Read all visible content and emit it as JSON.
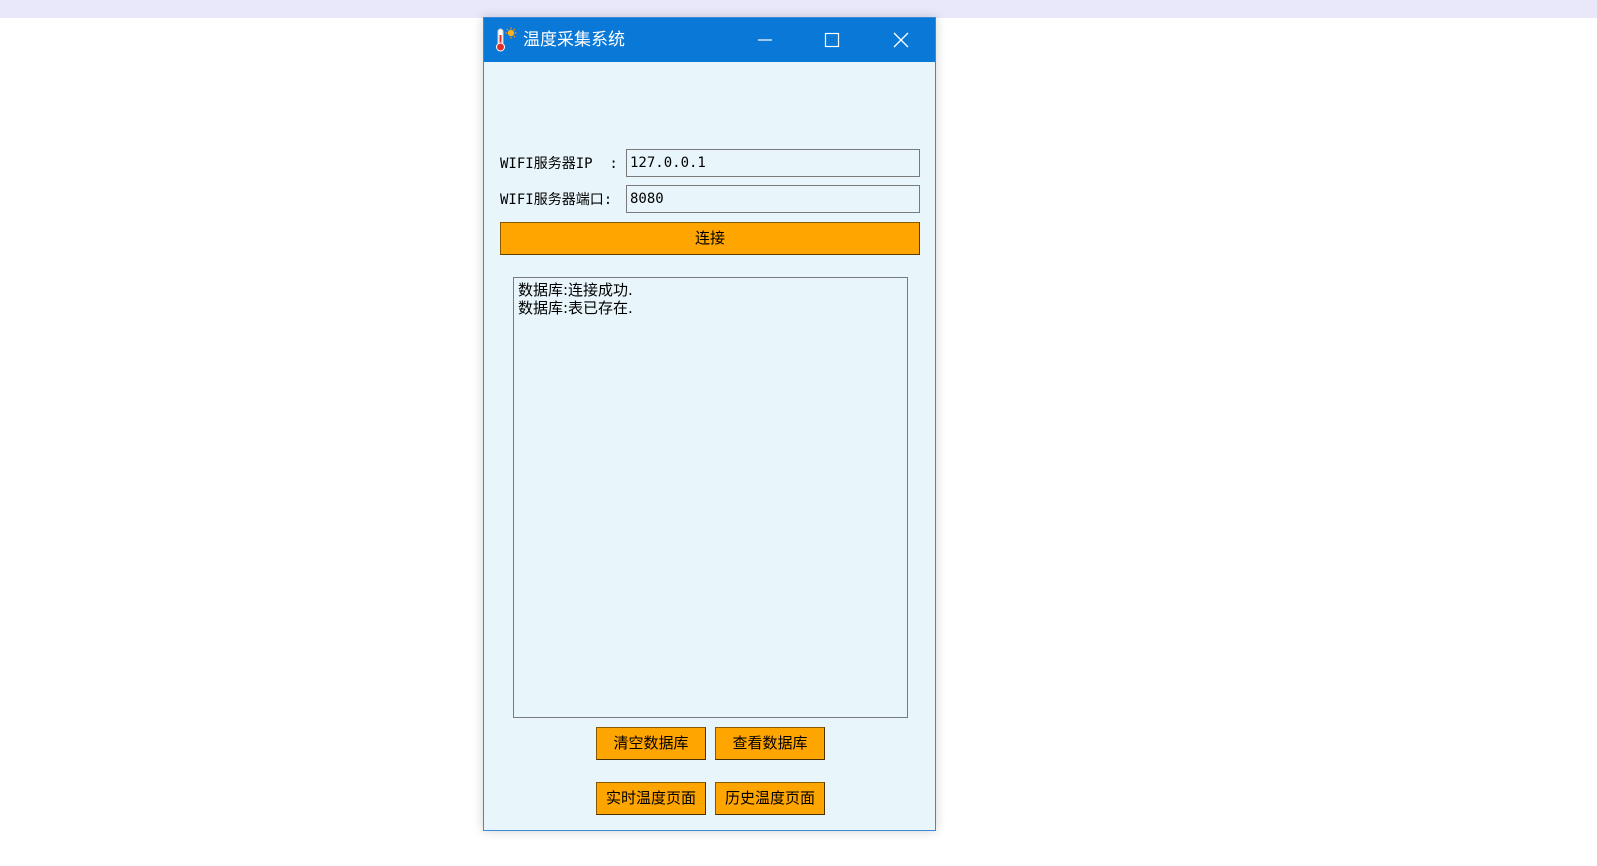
{
  "window": {
    "title": "温度采集系统",
    "app_icon": "thermometer-sun-icon",
    "controls": [
      "minimize-icon",
      "maximize-icon",
      "close-icon"
    ]
  },
  "form": {
    "ip_label": "WIFI服务器IP  :",
    "ip_value": "127.0.0.1",
    "port_label": "WIFI服务器端口:",
    "port_value": "8080",
    "connect_label": "连接"
  },
  "log": {
    "lines": [
      "数据库:连接成功.",
      "数据库:表已存在."
    ]
  },
  "buttons": {
    "clear_db": "清空数据库",
    "view_db": "查看数据库",
    "realtime_page": "实时温度页面",
    "history_page": "历史温度页面"
  },
  "colors": {
    "titlebar": "#0a78d7",
    "window_bg": "#e8f6fc",
    "button": "#ffa500"
  }
}
